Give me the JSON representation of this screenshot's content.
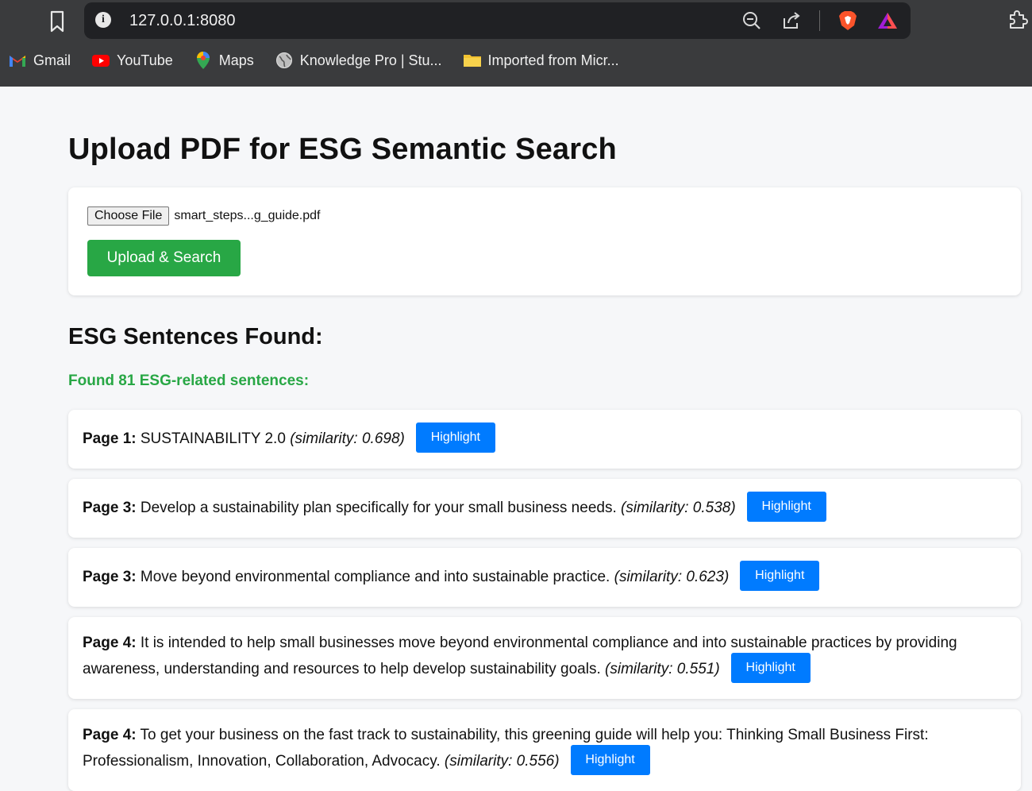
{
  "browser": {
    "url": "127.0.0.1:8080",
    "bookmarks": [
      {
        "label": "Gmail",
        "icon": "gmail-icon"
      },
      {
        "label": "YouTube",
        "icon": "youtube-icon"
      },
      {
        "label": "Maps",
        "icon": "maps-icon"
      },
      {
        "label": "Knowledge Pro | Stu...",
        "icon": "globe-icon"
      },
      {
        "label": "Imported from Micr...",
        "icon": "folder-icon"
      }
    ]
  },
  "page": {
    "title": "Upload PDF for ESG Semantic Search",
    "file_input": {
      "button_label": "Choose File",
      "file_name": "smart_steps...g_guide.pdf"
    },
    "upload_button": "Upload & Search",
    "results_title": "ESG Sentences Found:",
    "found_text": "Found 81 ESG-related sentences:",
    "highlight_label": "Highlight",
    "results": [
      {
        "page": "Page 1:",
        "text": "SUSTAINABILITY 2.0",
        "similarity": "(similarity: 0.698)"
      },
      {
        "page": "Page 3:",
        "text": "Develop a sustainability plan specifically for your small business needs.",
        "similarity": "(similarity: 0.538)"
      },
      {
        "page": "Page 3:",
        "text": "Move beyond environmental compliance and into sustainable practice.",
        "similarity": "(similarity: 0.623)"
      },
      {
        "page": "Page 4:",
        "text": "It is intended to help small businesses move beyond environmental compliance and into sustainable practices by providing awareness, understanding and resources to help develop sustainability goals.",
        "similarity": "(similarity: 0.551)"
      },
      {
        "page": "Page 4:",
        "text": "To get your business on the fast track to sustainability, this greening guide will help you: Thinking Small Business First: Professionalism, Innovation, Collaboration, Advocacy.",
        "similarity": "(similarity: 0.556)"
      }
    ]
  },
  "colors": {
    "success": "#28a745",
    "primary": "#007bff",
    "chrome": "#3a3b3d"
  }
}
